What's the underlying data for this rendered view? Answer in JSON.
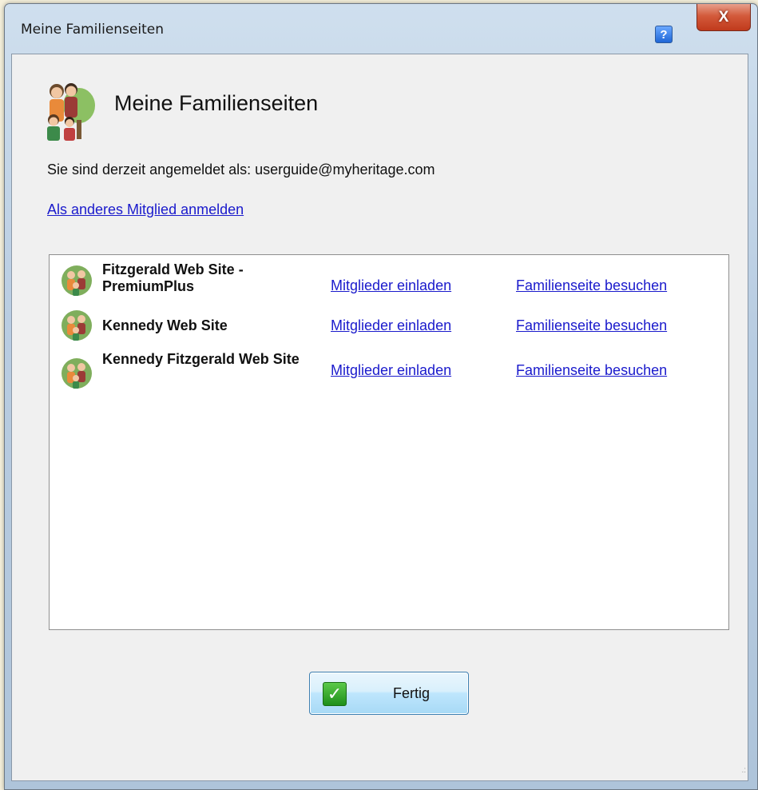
{
  "window": {
    "title": "Meine Familienseiten",
    "help_label": "?",
    "close_label": "X"
  },
  "dialog": {
    "heading": "Meine Familienseiten",
    "login_info": "Sie sind derzeit angemeldet als: userguide@myheritage.com",
    "switch_member_link": "Als anderes Mitglied anmelden"
  },
  "sites": [
    {
      "name": "Fitzgerald Web Site - PremiumPlus",
      "invite": "Mitglieder einladen",
      "visit": "Familienseite besuchen"
    },
    {
      "name": "Kennedy Web Site",
      "invite": "Mitglieder einladen",
      "visit": "Familienseite besuchen"
    },
    {
      "name": "Kennedy Fitzgerald Web Site",
      "invite": "Mitglieder einladen",
      "visit": "Familienseite besuchen"
    }
  ],
  "footer": {
    "done_label": "Fertig",
    "done_icon": "checkmark-icon"
  },
  "colors": {
    "link": "#1a1acc",
    "close_button": "#c03a1c",
    "help_button": "#1f66d6",
    "done_check": "#1e8f1a"
  }
}
